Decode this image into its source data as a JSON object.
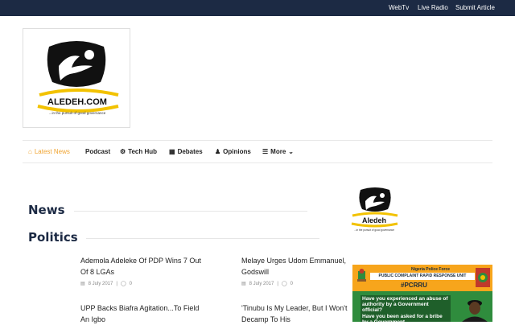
{
  "topbar": {
    "links": [
      "WebTv",
      "Live Radio",
      "Submit Article"
    ]
  },
  "logo": {
    "brand": "ALEDEH.COM",
    "tagline": "...in the pursuit of good governance"
  },
  "nav": {
    "items": [
      {
        "label": "Latest News",
        "icon": "home-icon"
      },
      {
        "label": "Podcast",
        "icon": ""
      },
      {
        "label": "Tech Hub",
        "icon": "gear-icon"
      },
      {
        "label": "Debates",
        "icon": "grid-icon"
      },
      {
        "label": "Opinions",
        "icon": "user-icon"
      },
      {
        "label": "More",
        "icon": "menu-icon"
      }
    ]
  },
  "sections": {
    "news": "News",
    "politics": "Politics"
  },
  "articles": [
    {
      "title": "Ademola Adeleke Of PDP Wins 7 Out Of 8 LGAs",
      "date": "8 July 2017",
      "comments": "0"
    },
    {
      "title": "Melaye Urges Udom Emmanuel, Godswill",
      "date": "8 July 2017",
      "comments": "0"
    },
    {
      "title": "UPP Backs Biafra Agitation...To Field An Igbo",
      "date": "",
      "comments": ""
    },
    {
      "title": "'Tinubu Is My Leader, But I Won't Decamp To His",
      "date": "",
      "comments": ""
    }
  ],
  "sidebar": {
    "logo_brand": "Aledeh",
    "logo_tagline": "...in the pursuit of good governance",
    "ad": {
      "line1": "Nigeria Police Force",
      "line2": "PUBLIC COMPLAINT RAPID RESPONSE UNIT",
      "hashtag": "#PCRRU",
      "q1": "Have you experienced an abuse of authority by a Government official?",
      "q2": "Have you been asked for a bribe by a Government"
    }
  },
  "colors": {
    "topbar": "#1c2a44",
    "accent": "#f0a431",
    "section_title": "#1c2a44"
  }
}
